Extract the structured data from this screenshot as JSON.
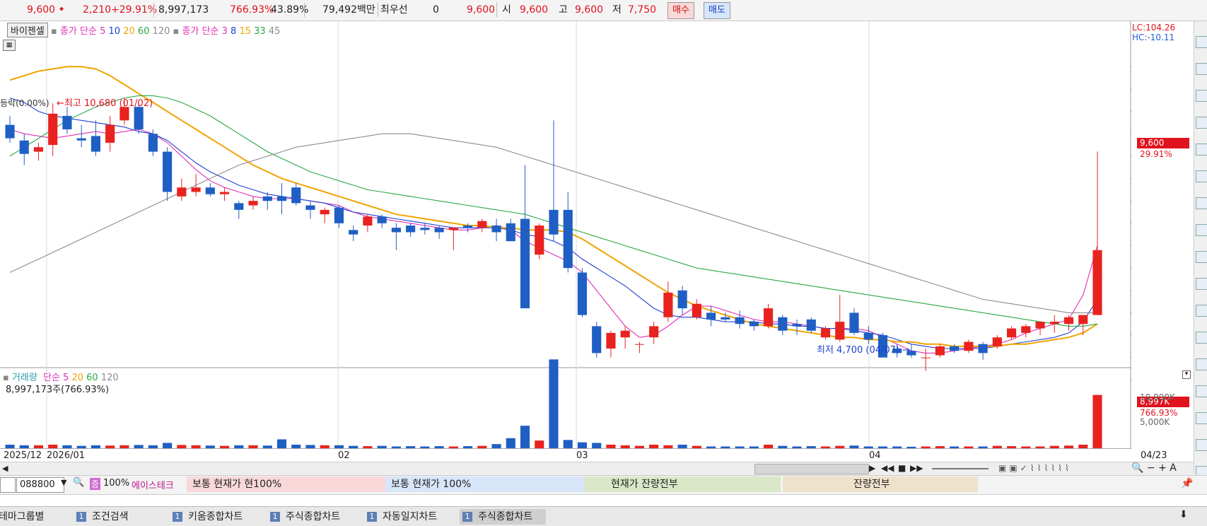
{
  "topbar": {
    "price": "9,600",
    "change": "2,210",
    "change_pct": "+29.91%",
    "volume": "8,997,173",
    "volume_ratio": "766.93%",
    "turnover_pct": "43.89%",
    "amount": "79,492백만",
    "best_label": "최우선",
    "best_qty": "0",
    "best_price": "9,600",
    "open_label": "시",
    "open_value": "9,600",
    "high_label": "고",
    "high_value": "9,600",
    "low_label": "저",
    "low_value": "7,750",
    "buy_label": "매수",
    "sell_label": "매도"
  },
  "legend": {
    "tool_label": "바이젠셀",
    "ma1_title": "종가 단순",
    "ma1_periods": [
      "5",
      "10",
      "20",
      "60",
      "120"
    ],
    "ma2_title": "종가 단순",
    "ma2_periods": [
      "3",
      "8",
      "15",
      "33",
      "45"
    ],
    "lc": "LC:104.26",
    "hc": "HC:-10.11"
  },
  "annotations": {
    "high": "←최고 10,680 (01/02)",
    "low": "최저 4,700 (04/07) →",
    "left_cut": "등락(0.00%)",
    "price_tag": "9,600",
    "price_tag_pct": "29.91%"
  },
  "volume_panel": {
    "title": "거래량",
    "ma_title": "단순",
    "ma_periods": [
      "5",
      "20",
      "60",
      "120"
    ],
    "value_line": "8,997,173주(766.93%)",
    "tag": "8,997K",
    "tag_pct": "766.93%",
    "axis_labels": [
      "10,000K",
      "5,000K"
    ]
  },
  "date_axis": {
    "labels": [
      "2025/12",
      "2026/01",
      "02",
      "03",
      "04",
      "04/23"
    ]
  },
  "bottombar": {
    "code": "088800",
    "zoom": "100%",
    "stock_name": "에이스테크",
    "pill1": "보통   현재가    현100%",
    "pill2": "보통   현재가      100%",
    "pill3": "현재가     잔량전부",
    "pill4": "잔량전부"
  },
  "tabs": [
    "테마그룹별",
    "조건검색",
    "키움종합차트",
    "주식종합차트",
    "자동일지차트",
    "주식종합차트"
  ],
  "tab_num": "1",
  "colors": {
    "up": "#e8231f",
    "down": "#1f5fc4",
    "ma5": "#e02fb6",
    "ma10": "#2240d0",
    "ma20": "#f0a400",
    "ma60": "#2aa845",
    "ma120": "#8c8c8c"
  },
  "chart_data": {
    "type": "candlestick",
    "price_axis": {
      "ticks": [
        4500,
        5000,
        5500,
        6000,
        6500,
        7000,
        7500,
        8000,
        8500,
        9000,
        9500,
        10000,
        10500,
        11000,
        11500
      ],
      "range": [
        4300,
        12200
      ]
    },
    "volume_axis_k": [
      5000,
      10000
    ],
    "candles": [
      {
        "o": 10200,
        "h": 10400,
        "l": 9800,
        "c": 9900
      },
      {
        "o": 9850,
        "h": 10000,
        "l": 9300,
        "c": 9550
      },
      {
        "o": 9600,
        "h": 9800,
        "l": 9400,
        "c": 9700
      },
      {
        "o": 9750,
        "h": 10680,
        "l": 9500,
        "c": 10450
      },
      {
        "o": 10400,
        "h": 10600,
        "l": 10000,
        "c": 10100
      },
      {
        "o": 9900,
        "h": 10200,
        "l": 9700,
        "c": 9850
      },
      {
        "o": 9950,
        "h": 10300,
        "l": 9500,
        "c": 9600
      },
      {
        "o": 9800,
        "h": 10400,
        "l": 9600,
        "c": 10200
      },
      {
        "o": 10300,
        "h": 10800,
        "l": 10200,
        "c": 10600
      },
      {
        "o": 10600,
        "h": 10700,
        "l": 10000,
        "c": 10100
      },
      {
        "o": 10000,
        "h": 10100,
        "l": 9500,
        "c": 9600
      },
      {
        "o": 9600,
        "h": 9700,
        "l": 8500,
        "c": 8700
      },
      {
        "o": 8600,
        "h": 9000,
        "l": 8500,
        "c": 8800
      },
      {
        "o": 8700,
        "h": 9100,
        "l": 8600,
        "c": 8800
      },
      {
        "o": 8800,
        "h": 8900,
        "l": 8600,
        "c": 8650
      },
      {
        "o": 8650,
        "h": 8800,
        "l": 8500,
        "c": 8700
      },
      {
        "o": 8450,
        "h": 8500,
        "l": 8100,
        "c": 8300
      },
      {
        "o": 8400,
        "h": 8600,
        "l": 8300,
        "c": 8500
      },
      {
        "o": 8600,
        "h": 8700,
        "l": 8300,
        "c": 8500
      },
      {
        "o": 8600,
        "h": 8900,
        "l": 8200,
        "c": 8500
      },
      {
        "o": 8800,
        "h": 8900,
        "l": 8400,
        "c": 8450
      },
      {
        "o": 8400,
        "h": 8500,
        "l": 8100,
        "c": 8300
      },
      {
        "o": 8200,
        "h": 8350,
        "l": 8000,
        "c": 8300
      },
      {
        "o": 8350,
        "h": 8400,
        "l": 7900,
        "c": 8000
      },
      {
        "o": 7850,
        "h": 7950,
        "l": 7600,
        "c": 7750
      },
      {
        "o": 7950,
        "h": 8200,
        "l": 7800,
        "c": 8150
      },
      {
        "o": 8150,
        "h": 8200,
        "l": 7900,
        "c": 8000
      },
      {
        "o": 7900,
        "h": 8000,
        "l": 7400,
        "c": 7800
      },
      {
        "o": 7950,
        "h": 8000,
        "l": 7700,
        "c": 7800
      },
      {
        "o": 7900,
        "h": 8000,
        "l": 7750,
        "c": 7850
      },
      {
        "o": 7900,
        "h": 7950,
        "l": 7650,
        "c": 7800
      },
      {
        "o": 7850,
        "h": 7900,
        "l": 7400,
        "c": 7900
      },
      {
        "o": 7950,
        "h": 8000,
        "l": 7800,
        "c": 7900
      },
      {
        "o": 7900,
        "h": 8100,
        "l": 7800,
        "c": 8050
      },
      {
        "o": 7950,
        "h": 8100,
        "l": 7600,
        "c": 7800
      },
      {
        "o": 8000,
        "h": 8100,
        "l": 7600,
        "c": 7600
      },
      {
        "o": 8100,
        "h": 9300,
        "l": 6100,
        "c": 6100
      },
      {
        "o": 7300,
        "h": 8000,
        "l": 7200,
        "c": 7950
      },
      {
        "o": 8300,
        "h": 10300,
        "l": 7600,
        "c": 7750
      },
      {
        "o": 8300,
        "h": 8700,
        "l": 6900,
        "c": 7000
      },
      {
        "o": 6900,
        "h": 7000,
        "l": 5900,
        "c": 5950
      },
      {
        "o": 5700,
        "h": 5800,
        "l": 5000,
        "c": 5100
      },
      {
        "o": 5200,
        "h": 5600,
        "l": 5000,
        "c": 5550
      },
      {
        "o": 5450,
        "h": 5700,
        "l": 5200,
        "c": 5600
      },
      {
        "o": 5300,
        "h": 5350,
        "l": 5100,
        "c": 5300
      },
      {
        "o": 5450,
        "h": 5800,
        "l": 5300,
        "c": 5700
      },
      {
        "o": 5900,
        "h": 6700,
        "l": 5800,
        "c": 6450
      },
      {
        "o": 6500,
        "h": 6600,
        "l": 5950,
        "c": 6100
      },
      {
        "o": 5900,
        "h": 6300,
        "l": 5850,
        "c": 6200
      },
      {
        "o": 6000,
        "h": 6150,
        "l": 5700,
        "c": 5850
      },
      {
        "o": 5900,
        "h": 6000,
        "l": 5800,
        "c": 5850
      },
      {
        "o": 5900,
        "h": 6050,
        "l": 5650,
        "c": 5750
      },
      {
        "o": 5800,
        "h": 5850,
        "l": 5600,
        "c": 5700
      },
      {
        "o": 5700,
        "h": 6200,
        "l": 5650,
        "c": 6100
      },
      {
        "o": 5900,
        "h": 5950,
        "l": 5500,
        "c": 5600
      },
      {
        "o": 5750,
        "h": 5850,
        "l": 5500,
        "c": 5700
      },
      {
        "o": 5850,
        "h": 5900,
        "l": 5550,
        "c": 5600
      },
      {
        "o": 5450,
        "h": 5700,
        "l": 5400,
        "c": 5650
      },
      {
        "o": 5400,
        "h": 6400,
        "l": 5350,
        "c": 5800
      },
      {
        "o": 6000,
        "h": 6100,
        "l": 5500,
        "c": 5550
      },
      {
        "o": 5550,
        "h": 5700,
        "l": 5300,
        "c": 5400
      },
      {
        "o": 5500,
        "h": 5550,
        "l": 5000,
        "c": 5000
      },
      {
        "o": 5200,
        "h": 5300,
        "l": 5000,
        "c": 5100
      },
      {
        "o": 5150,
        "h": 5300,
        "l": 5000,
        "c": 5050
      },
      {
        "o": 5000,
        "h": 5200,
        "l": 4700,
        "c": 5000
      },
      {
        "o": 5050,
        "h": 5300,
        "l": 5000,
        "c": 5250
      },
      {
        "o": 5250,
        "h": 5300,
        "l": 5100,
        "c": 5150
      },
      {
        "o": 5150,
        "h": 5400,
        "l": 5100,
        "c": 5350
      },
      {
        "o": 5300,
        "h": 5350,
        "l": 4950,
        "c": 5100
      },
      {
        "o": 5250,
        "h": 5500,
        "l": 5200,
        "c": 5450
      },
      {
        "o": 5450,
        "h": 5700,
        "l": 5400,
        "c": 5650
      },
      {
        "o": 5550,
        "h": 5750,
        "l": 5450,
        "c": 5700
      },
      {
        "o": 5650,
        "h": 5800,
        "l": 5500,
        "c": 5800
      },
      {
        "o": 5750,
        "h": 5950,
        "l": 5550,
        "c": 5800
      },
      {
        "o": 5750,
        "h": 5950,
        "l": 5600,
        "c": 5900
      },
      {
        "o": 5750,
        "h": 5900,
        "l": 5500,
        "c": 5950
      },
      {
        "o": 5950,
        "h": 9600,
        "l": 5950,
        "c": 7400
      }
    ],
    "volume_k": [
      600,
      500,
      500,
      600,
      500,
      400,
      500,
      450,
      500,
      550,
      500,
      900,
      550,
      500,
      450,
      400,
      500,
      500,
      450,
      1500,
      600,
      550,
      500,
      500,
      400,
      350,
      400,
      300,
      350,
      300,
      350,
      300,
      350,
      400,
      700,
      1700,
      3800,
      1300,
      15000,
      1400,
      1000,
      900,
      600,
      500,
      400,
      600,
      500,
      600,
      400,
      300,
      300,
      300,
      300,
      600,
      400,
      300,
      350,
      300,
      400,
      450,
      300,
      300,
      300,
      250,
      300,
      350,
      300,
      300,
      300,
      400,
      350,
      300,
      300,
      400,
      450,
      600,
      9000
    ],
    "ma_lines": {
      "ma5": [
        10100,
        10000,
        9950,
        9900,
        9950,
        10000,
        10050,
        10000,
        10050,
        10100,
        10000,
        9800,
        9500,
        9200,
        8950,
        8800,
        8700,
        8600,
        8550,
        8550,
        8550,
        8500,
        8450,
        8400,
        8250,
        8150,
        8100,
        8050,
        8000,
        7950,
        7900,
        7850,
        7850,
        7900,
        7950,
        7850,
        7600,
        7450,
        7300,
        7150,
        6900,
        6500,
        6100,
        5700,
        5450,
        5500,
        5700,
        5950,
        6150,
        6150,
        6050,
        5950,
        5850,
        5800,
        5800,
        5750,
        5700,
        5650,
        5650,
        5650,
        5600,
        5450,
        5300,
        5150,
        5100,
        5100,
        5150,
        5200,
        5250,
        5300,
        5400,
        5550,
        5650,
        5750,
        5850,
        6400,
        7500
      ],
      "ma10": [
        10800,
        10700,
        10500,
        10400,
        10350,
        10300,
        10250,
        10200,
        10150,
        10050,
        10000,
        9850,
        9600,
        9350,
        9150,
        9000,
        8850,
        8750,
        8650,
        8600,
        8550,
        8500,
        8450,
        8350,
        8250,
        8200,
        8150,
        8100,
        8050,
        8000,
        7950,
        7900,
        7900,
        7900,
        7900,
        7850,
        7750,
        7700,
        7600,
        7450,
        7200,
        7000,
        6800,
        6600,
        6350,
        6100,
        5950,
        5900,
        5900,
        5850,
        5800,
        5800,
        5800,
        5750,
        5750,
        5700,
        5700,
        5650,
        5650,
        5600,
        5550,
        5500,
        5400,
        5300,
        5250,
        5200,
        5200,
        5200,
        5200,
        5250,
        5300,
        5350,
        5400,
        5450,
        5550,
        5800,
        6300
      ],
      "ma20": [
        11200,
        11300,
        11400,
        11450,
        11500,
        11500,
        11450,
        11300,
        11100,
        10900,
        10700,
        10500,
        10300,
        10100,
        9900,
        9700,
        9500,
        9300,
        9150,
        9000,
        8900,
        8800,
        8700,
        8600,
        8500,
        8400,
        8300,
        8200,
        8150,
        8100,
        8050,
        8000,
        7950,
        7950,
        7900,
        7900,
        7850,
        7850,
        7850,
        7800,
        7650,
        7450,
        7250,
        7050,
        6850,
        6650,
        6450,
        6300,
        6150,
        6050,
        5950,
        5850,
        5750,
        5700,
        5650,
        5600,
        5550,
        5500,
        5450,
        5450,
        5400,
        5400,
        5350,
        5350,
        5300,
        5300,
        5250,
        5250,
        5250,
        5250,
        5300,
        5300,
        5350,
        5400,
        5450,
        5550,
        5750
      ],
      "ma60": [
        9500,
        9700,
        9900,
        10100,
        10300,
        10450,
        10600,
        10700,
        10800,
        10850,
        10850,
        10800,
        10700,
        10550,
        10400,
        10200,
        10000,
        9800,
        9600,
        9450,
        9300,
        9150,
        9050,
        8950,
        8850,
        8750,
        8700,
        8650,
        8600,
        8550,
        8500,
        8450,
        8400,
        8350,
        8300,
        8250,
        8200,
        8100,
        8000,
        7900,
        7800,
        7700,
        7600,
        7500,
        7400,
        7300,
        7200,
        7100,
        7000,
        6950,
        6900,
        6850,
        6800,
        6750,
        6700,
        6650,
        6600,
        6550,
        6500,
        6450,
        6400,
        6350,
        6300,
        6250,
        6200,
        6150,
        6100,
        6050,
        6000,
        5950,
        5900,
        5850,
        5800,
        5750,
        5700,
        5700,
        5750
      ],
      "ma120": [
        6900,
        7050,
        7200,
        7350,
        7500,
        7650,
        7800,
        7950,
        8100,
        8250,
        8400,
        8550,
        8700,
        8850,
        9000,
        9150,
        9300,
        9400,
        9500,
        9600,
        9700,
        9750,
        9800,
        9850,
        9900,
        9950,
        10000,
        10000,
        10000,
        9950,
        9900,
        9850,
        9800,
        9750,
        9700,
        9600,
        9500,
        9400,
        9300,
        9200,
        9100,
        9000,
        8900,
        8800,
        8700,
        8600,
        8500,
        8400,
        8300,
        8200,
        8100,
        8000,
        7900,
        7800,
        7700,
        7600,
        7500,
        7400,
        7300,
        7200,
        7100,
        7000,
        6900,
        6800,
        6700,
        6600,
        6500,
        6400,
        6300,
        6250,
        6200,
        6150,
        6100,
        6050,
        6000,
        6000,
        6000
      ]
    }
  }
}
